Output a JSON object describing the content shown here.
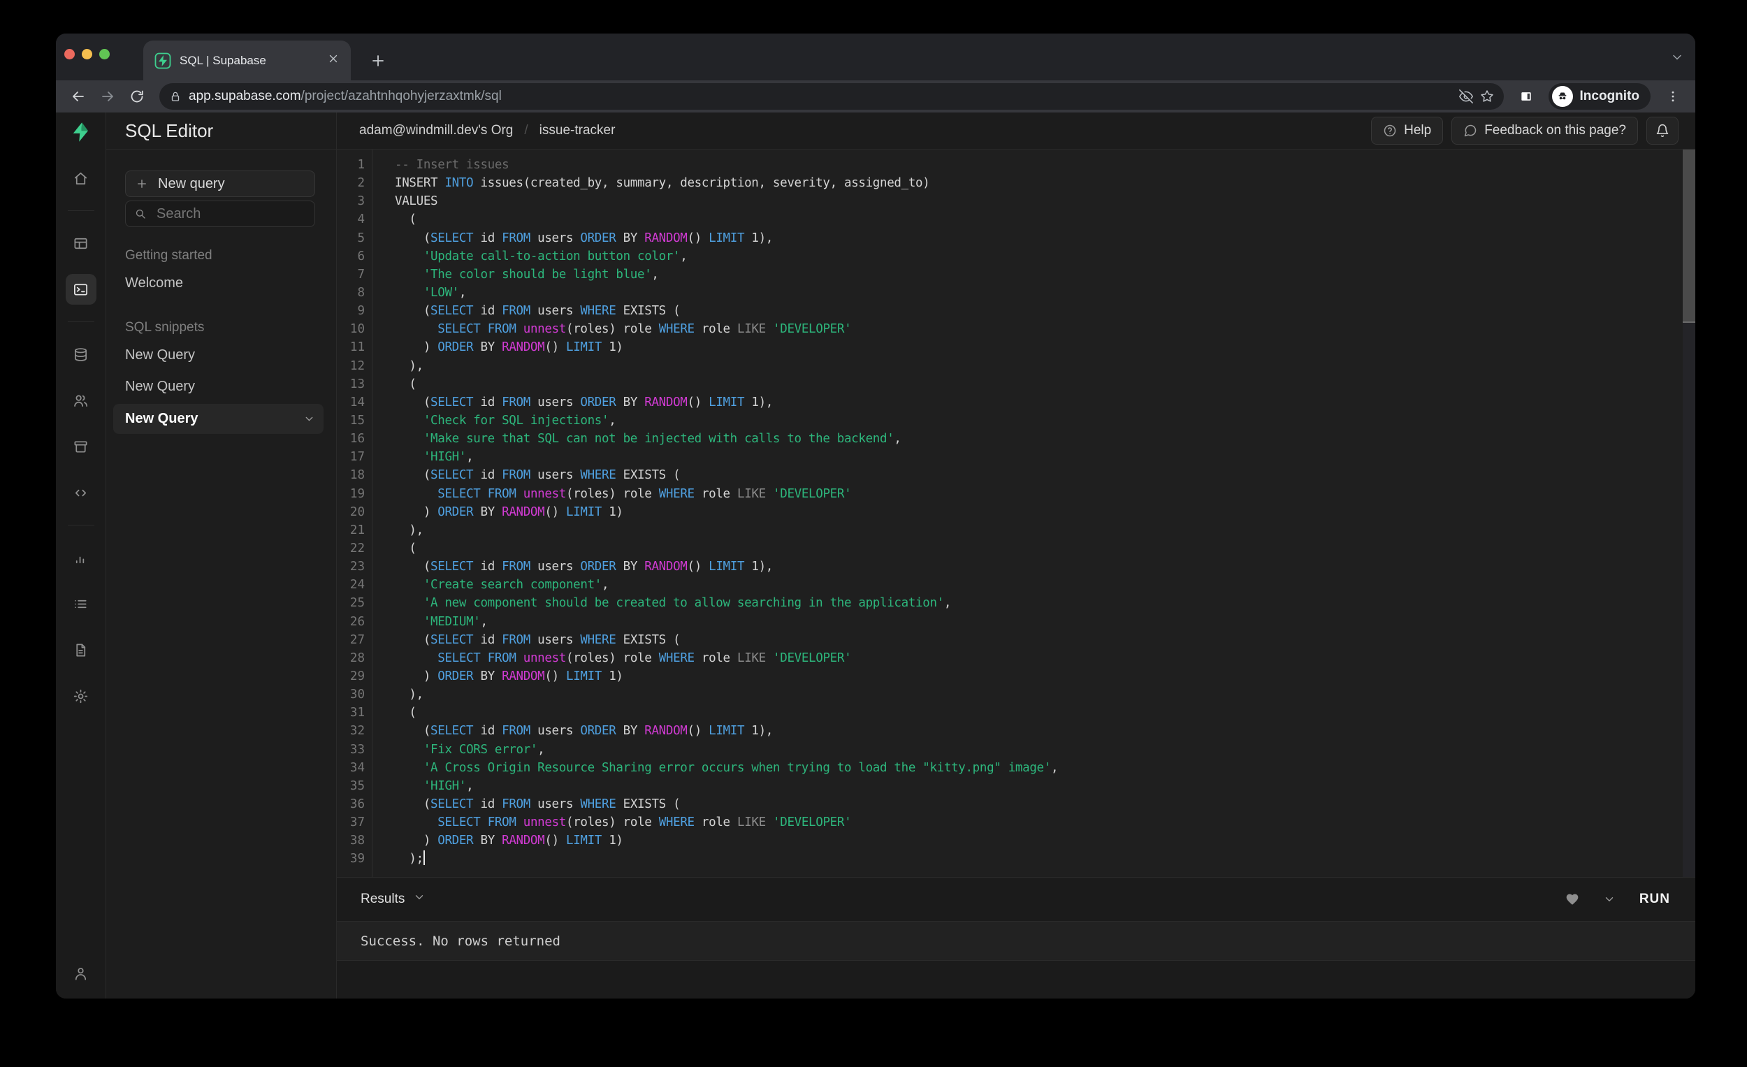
{
  "colors": {
    "supabase_green": "#3ECF8E",
    "supabase_green_dark": "#249361",
    "syntax_keyword": "#4fa0e0",
    "syntax_function": "#d13bd3",
    "syntax_string": "#2db67c",
    "syntax_operator": "#8b8b8b",
    "syntax_comment": "#6a6a6a",
    "syntax_text": "#d4d4d4"
  },
  "browser": {
    "tab_title": "SQL | Supabase",
    "url_host": "app.supabase.com",
    "url_path": "/project/azahtnhqohyjerzaxtmk/sql",
    "incognito_label": "Incognito"
  },
  "header": {
    "breadcrumb_org": "adam@windmill.dev's Org",
    "breadcrumb_sep": "/",
    "breadcrumb_project": "issue-tracker",
    "help_label": "Help",
    "feedback_label": "Feedback on this page?"
  },
  "rail": {
    "items": [
      {
        "id": "home",
        "icon": "home-icon"
      },
      {
        "type": "divider"
      },
      {
        "id": "table-editor",
        "icon": "table-editor-icon"
      },
      {
        "id": "sql-editor",
        "icon": "sql-editor-icon",
        "active": true
      },
      {
        "type": "divider"
      },
      {
        "id": "database",
        "icon": "database-icon"
      },
      {
        "id": "auth",
        "icon": "auth-users-icon"
      },
      {
        "id": "storage",
        "icon": "storage-archive-icon"
      },
      {
        "id": "edge-functions",
        "icon": "code-brackets-icon"
      },
      {
        "type": "divider"
      },
      {
        "id": "reports",
        "icon": "bar-chart-icon"
      },
      {
        "id": "logs",
        "icon": "list-icon"
      },
      {
        "id": "api-docs",
        "icon": "document-icon"
      },
      {
        "id": "settings",
        "icon": "gear-icon"
      }
    ],
    "bottom_item": {
      "id": "account",
      "icon": "user-icon"
    }
  },
  "sidebar": {
    "title": "SQL Editor",
    "new_query_button": "New query",
    "search_placeholder": "Search",
    "sections": [
      {
        "label": "Getting started",
        "items": [
          {
            "label": "Welcome",
            "selected": false
          }
        ]
      },
      {
        "label": "SQL snippets",
        "items": [
          {
            "label": "New Query",
            "selected": false
          },
          {
            "label": "New Query",
            "selected": false
          },
          {
            "label": "New Query",
            "selected": true
          }
        ]
      }
    ]
  },
  "editor": {
    "lines": [
      {
        "seg": [
          [
            "cm",
            "-- Insert issues"
          ]
        ]
      },
      {
        "seg": [
          [
            "tx",
            "INSERT "
          ],
          [
            "kw",
            "INTO"
          ],
          [
            "tx",
            " issues(created_by, summary, description, severity, assigned_to)"
          ]
        ]
      },
      {
        "seg": [
          [
            "tx",
            "VALUES"
          ]
        ]
      },
      {
        "seg": [
          [
            "tx",
            "  ("
          ]
        ]
      },
      {
        "seg": [
          [
            "tx",
            "    ("
          ],
          [
            "kw",
            "SELECT"
          ],
          [
            "tx",
            " id "
          ],
          [
            "kw",
            "FROM"
          ],
          [
            "tx",
            " users "
          ],
          [
            "kw",
            "ORDER"
          ],
          [
            "tx",
            " BY "
          ],
          [
            "fn",
            "RANDOM"
          ],
          [
            "tx",
            "() "
          ],
          [
            "kw",
            "LIMIT"
          ],
          [
            "tx",
            " 1),"
          ]
        ]
      },
      {
        "seg": [
          [
            "tx",
            "    "
          ],
          [
            "st",
            "'Update call-to-action button color'"
          ],
          [
            "tx",
            ","
          ]
        ]
      },
      {
        "seg": [
          [
            "tx",
            "    "
          ],
          [
            "st",
            "'The color should be light blue'"
          ],
          [
            "tx",
            ","
          ]
        ]
      },
      {
        "seg": [
          [
            "tx",
            "    "
          ],
          [
            "st",
            "'LOW'"
          ],
          [
            "tx",
            ","
          ]
        ]
      },
      {
        "seg": [
          [
            "tx",
            "    ("
          ],
          [
            "kw",
            "SELECT"
          ],
          [
            "tx",
            " id "
          ],
          [
            "kw",
            "FROM"
          ],
          [
            "tx",
            " users "
          ],
          [
            "kw",
            "WHERE"
          ],
          [
            "tx",
            " EXISTS ("
          ]
        ]
      },
      {
        "seg": [
          [
            "tx",
            "      "
          ],
          [
            "kw",
            "SELECT"
          ],
          [
            "tx",
            " "
          ],
          [
            "kw",
            "FROM"
          ],
          [
            "tx",
            " "
          ],
          [
            "fn",
            "unnest"
          ],
          [
            "tx",
            "(roles) role "
          ],
          [
            "kw",
            "WHERE"
          ],
          [
            "tx",
            " role "
          ],
          [
            "op",
            "LIKE"
          ],
          [
            "tx",
            " "
          ],
          [
            "st",
            "'DEVELOPER'"
          ]
        ]
      },
      {
        "seg": [
          [
            "tx",
            "    ) "
          ],
          [
            "kw",
            "ORDER"
          ],
          [
            "tx",
            " BY "
          ],
          [
            "fn",
            "RANDOM"
          ],
          [
            "tx",
            "() "
          ],
          [
            "kw",
            "LIMIT"
          ],
          [
            "tx",
            " 1)"
          ]
        ]
      },
      {
        "seg": [
          [
            "tx",
            "  ),"
          ]
        ]
      },
      {
        "seg": [
          [
            "tx",
            "  ("
          ]
        ]
      },
      {
        "seg": [
          [
            "tx",
            "    ("
          ],
          [
            "kw",
            "SELECT"
          ],
          [
            "tx",
            " id "
          ],
          [
            "kw",
            "FROM"
          ],
          [
            "tx",
            " users "
          ],
          [
            "kw",
            "ORDER"
          ],
          [
            "tx",
            " BY "
          ],
          [
            "fn",
            "RANDOM"
          ],
          [
            "tx",
            "() "
          ],
          [
            "kw",
            "LIMIT"
          ],
          [
            "tx",
            " 1),"
          ]
        ]
      },
      {
        "seg": [
          [
            "tx",
            "    "
          ],
          [
            "st",
            "'Check for SQL injections'"
          ],
          [
            "tx",
            ","
          ]
        ]
      },
      {
        "seg": [
          [
            "tx",
            "    "
          ],
          [
            "st",
            "'Make sure that SQL can not be injected with calls to the backend'"
          ],
          [
            "tx",
            ","
          ]
        ]
      },
      {
        "seg": [
          [
            "tx",
            "    "
          ],
          [
            "st",
            "'HIGH'"
          ],
          [
            "tx",
            ","
          ]
        ]
      },
      {
        "seg": [
          [
            "tx",
            "    ("
          ],
          [
            "kw",
            "SELECT"
          ],
          [
            "tx",
            " id "
          ],
          [
            "kw",
            "FROM"
          ],
          [
            "tx",
            " users "
          ],
          [
            "kw",
            "WHERE"
          ],
          [
            "tx",
            " EXISTS ("
          ]
        ]
      },
      {
        "seg": [
          [
            "tx",
            "      "
          ],
          [
            "kw",
            "SELECT"
          ],
          [
            "tx",
            " "
          ],
          [
            "kw",
            "FROM"
          ],
          [
            "tx",
            " "
          ],
          [
            "fn",
            "unnest"
          ],
          [
            "tx",
            "(roles) role "
          ],
          [
            "kw",
            "WHERE"
          ],
          [
            "tx",
            " role "
          ],
          [
            "op",
            "LIKE"
          ],
          [
            "tx",
            " "
          ],
          [
            "st",
            "'DEVELOPER'"
          ]
        ]
      },
      {
        "seg": [
          [
            "tx",
            "    ) "
          ],
          [
            "kw",
            "ORDER"
          ],
          [
            "tx",
            " BY "
          ],
          [
            "fn",
            "RANDOM"
          ],
          [
            "tx",
            "() "
          ],
          [
            "kw",
            "LIMIT"
          ],
          [
            "tx",
            " 1)"
          ]
        ]
      },
      {
        "seg": [
          [
            "tx",
            "  ),"
          ]
        ]
      },
      {
        "seg": [
          [
            "tx",
            "  ("
          ]
        ]
      },
      {
        "seg": [
          [
            "tx",
            "    ("
          ],
          [
            "kw",
            "SELECT"
          ],
          [
            "tx",
            " id "
          ],
          [
            "kw",
            "FROM"
          ],
          [
            "tx",
            " users "
          ],
          [
            "kw",
            "ORDER"
          ],
          [
            "tx",
            " BY "
          ],
          [
            "fn",
            "RANDOM"
          ],
          [
            "tx",
            "() "
          ],
          [
            "kw",
            "LIMIT"
          ],
          [
            "tx",
            " 1),"
          ]
        ]
      },
      {
        "seg": [
          [
            "tx",
            "    "
          ],
          [
            "st",
            "'Create search component'"
          ],
          [
            "tx",
            ","
          ]
        ]
      },
      {
        "seg": [
          [
            "tx",
            "    "
          ],
          [
            "st",
            "'A new component should be created to allow searching in the application'"
          ],
          [
            "tx",
            ","
          ]
        ]
      },
      {
        "seg": [
          [
            "tx",
            "    "
          ],
          [
            "st",
            "'MEDIUM'"
          ],
          [
            "tx",
            ","
          ]
        ]
      },
      {
        "seg": [
          [
            "tx",
            "    ("
          ],
          [
            "kw",
            "SELECT"
          ],
          [
            "tx",
            " id "
          ],
          [
            "kw",
            "FROM"
          ],
          [
            "tx",
            " users "
          ],
          [
            "kw",
            "WHERE"
          ],
          [
            "tx",
            " EXISTS ("
          ]
        ]
      },
      {
        "seg": [
          [
            "tx",
            "      "
          ],
          [
            "kw",
            "SELECT"
          ],
          [
            "tx",
            " "
          ],
          [
            "kw",
            "FROM"
          ],
          [
            "tx",
            " "
          ],
          [
            "fn",
            "unnest"
          ],
          [
            "tx",
            "(roles) role "
          ],
          [
            "kw",
            "WHERE"
          ],
          [
            "tx",
            " role "
          ],
          [
            "op",
            "LIKE"
          ],
          [
            "tx",
            " "
          ],
          [
            "st",
            "'DEVELOPER'"
          ]
        ]
      },
      {
        "seg": [
          [
            "tx",
            "    ) "
          ],
          [
            "kw",
            "ORDER"
          ],
          [
            "tx",
            " BY "
          ],
          [
            "fn",
            "RANDOM"
          ],
          [
            "tx",
            "() "
          ],
          [
            "kw",
            "LIMIT"
          ],
          [
            "tx",
            " 1)"
          ]
        ]
      },
      {
        "seg": [
          [
            "tx",
            "  ),"
          ]
        ]
      },
      {
        "seg": [
          [
            "tx",
            "  ("
          ]
        ]
      },
      {
        "seg": [
          [
            "tx",
            "    ("
          ],
          [
            "kw",
            "SELECT"
          ],
          [
            "tx",
            " id "
          ],
          [
            "kw",
            "FROM"
          ],
          [
            "tx",
            " users "
          ],
          [
            "kw",
            "ORDER"
          ],
          [
            "tx",
            " BY "
          ],
          [
            "fn",
            "RANDOM"
          ],
          [
            "tx",
            "() "
          ],
          [
            "kw",
            "LIMIT"
          ],
          [
            "tx",
            " 1),"
          ]
        ]
      },
      {
        "seg": [
          [
            "tx",
            "    "
          ],
          [
            "st",
            "'Fix CORS error'"
          ],
          [
            "tx",
            ","
          ]
        ]
      },
      {
        "seg": [
          [
            "tx",
            "    "
          ],
          [
            "st",
            "'A Cross Origin Resource Sharing error occurs when trying to load the \"kitty.png\" image'"
          ],
          [
            "tx",
            ","
          ]
        ]
      },
      {
        "seg": [
          [
            "tx",
            "    "
          ],
          [
            "st",
            "'HIGH'"
          ],
          [
            "tx",
            ","
          ]
        ]
      },
      {
        "seg": [
          [
            "tx",
            "    ("
          ],
          [
            "kw",
            "SELECT"
          ],
          [
            "tx",
            " id "
          ],
          [
            "kw",
            "FROM"
          ],
          [
            "tx",
            " users "
          ],
          [
            "kw",
            "WHERE"
          ],
          [
            "tx",
            " EXISTS ("
          ]
        ]
      },
      {
        "seg": [
          [
            "tx",
            "      "
          ],
          [
            "kw",
            "SELECT"
          ],
          [
            "tx",
            " "
          ],
          [
            "kw",
            "FROM"
          ],
          [
            "tx",
            " "
          ],
          [
            "fn",
            "unnest"
          ],
          [
            "tx",
            "(roles) role "
          ],
          [
            "kw",
            "WHERE"
          ],
          [
            "tx",
            " role "
          ],
          [
            "op",
            "LIKE"
          ],
          [
            "tx",
            " "
          ],
          [
            "st",
            "'DEVELOPER'"
          ]
        ]
      },
      {
        "seg": [
          [
            "tx",
            "    ) "
          ],
          [
            "kw",
            "ORDER"
          ],
          [
            "tx",
            " BY "
          ],
          [
            "fn",
            "RANDOM"
          ],
          [
            "tx",
            "() "
          ],
          [
            "kw",
            "LIMIT"
          ],
          [
            "tx",
            " 1)"
          ]
        ]
      },
      {
        "seg": [
          [
            "tx",
            "  );"
          ]
        ],
        "cursor": true
      }
    ]
  },
  "results": {
    "label": "Results",
    "run_label": "RUN",
    "message": "Success. No rows returned"
  }
}
